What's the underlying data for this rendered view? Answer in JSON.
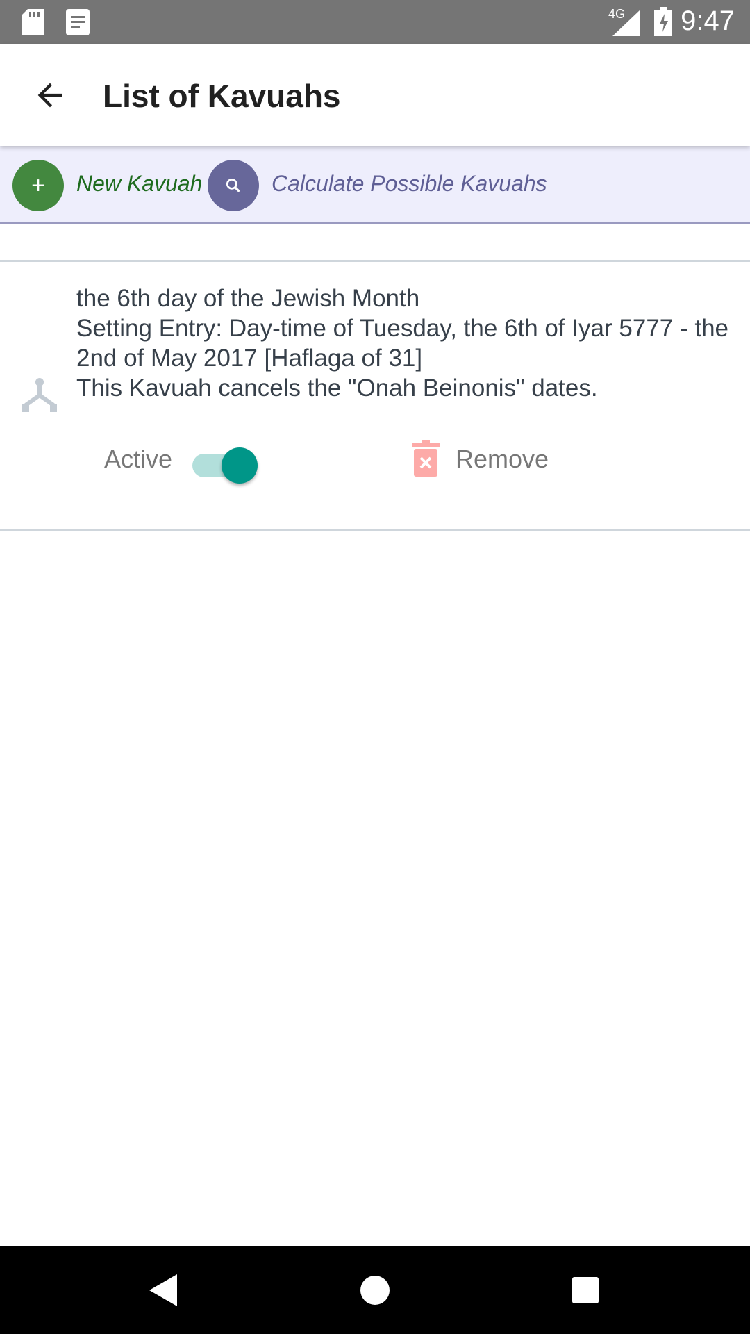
{
  "status_bar": {
    "time": "9:47",
    "network": "4G",
    "icons": [
      "sd-card-icon",
      "notification-icon",
      "signal-icon",
      "battery-charging-icon"
    ]
  },
  "app_bar": {
    "title": "List of Kavuahs",
    "back_icon": "arrow-back-icon"
  },
  "toolbar": {
    "new_label": "New Kavuah",
    "calculate_label": "Calculate Possible Kavuahs",
    "new_color": "#43883f",
    "calc_color": "#67679a"
  },
  "kavuahs": [
    {
      "lines": [
        "the 6th day of the Jewish Month",
        "Setting Entry: Day-time of Tuesday, the 6th of Iyar 5777 - the 2nd of May 2017 [Haflaga of 31]",
        "This Kavuah cancels the \"Onah Beinonis\" dates."
      ],
      "active_label": "Active",
      "active": true,
      "remove_label": "Remove",
      "toggle_color": "#009688"
    }
  ]
}
